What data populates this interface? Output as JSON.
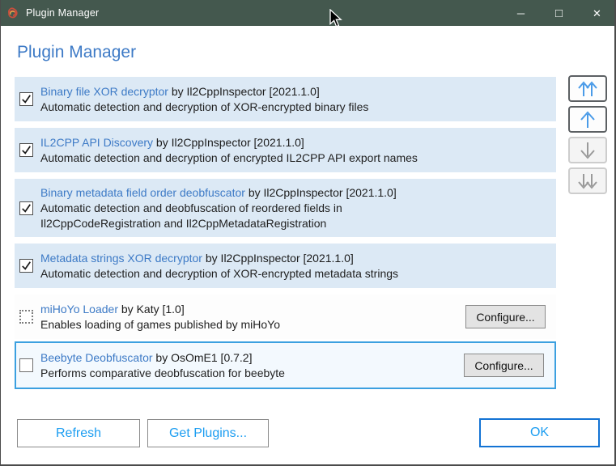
{
  "window": {
    "title": "Plugin Manager",
    "controls": {
      "minimize": "─",
      "maximize": "□",
      "close": "✕"
    }
  },
  "header": {
    "title": "Plugin Manager"
  },
  "plugins": [
    {
      "name": "Binary file XOR decryptor",
      "meta": "by Il2CppInspector [2021.1.0]",
      "description": "Automatic detection and decryption of XOR-encrypted binary files",
      "state": "checked"
    },
    {
      "name": "IL2CPP API Discovery",
      "meta": "by Il2CppInspector [2021.1.0]",
      "description": "Automatic detection and decryption of encrypted IL2CPP API export names",
      "state": "checked"
    },
    {
      "name": "Binary metadata field order deobfuscator",
      "meta": "by Il2CppInspector [2021.1.0]",
      "description": "Automatic detection and deobfuscation of reordered fields in\nIl2CppCodeRegistration and Il2CppMetadataRegistration",
      "state": "checked"
    },
    {
      "name": "Metadata strings XOR decryptor",
      "meta": "by Il2CppInspector [2021.1.0]",
      "description": "Automatic detection and decryption of XOR-encrypted metadata strings",
      "state": "checked"
    },
    {
      "name": "miHoYo Loader",
      "meta": "by Katy [1.0]",
      "description": "Enables loading of games published by miHoYo",
      "state": "indeterminate",
      "configure_label": "Configure..."
    },
    {
      "name": "Beebyte Deobfuscator",
      "meta": "by OsOmE1 [0.7.2]",
      "description": "Performs comparative deobfuscation for beebyte",
      "state": "unchecked",
      "selected": true,
      "configure_label": "Configure..."
    }
  ],
  "reorder": {
    "buttons": [
      {
        "name": "move-to-top",
        "enabled": true
      },
      {
        "name": "move-up",
        "enabled": true
      },
      {
        "name": "move-down",
        "enabled": false
      },
      {
        "name": "move-to-bottom",
        "enabled": false
      }
    ]
  },
  "footer": {
    "refresh": "Refresh",
    "get_plugins": "Get Plugins...",
    "ok": "OK"
  },
  "colors": {
    "titlebar": "#44584e",
    "heading_blue": "#3d7ac6",
    "row_bg_checked": "#dce9f5",
    "selected_border": "#3ba0e0",
    "button_text_blue": "#1b9df1",
    "ok_border_blue": "#1373d4"
  }
}
